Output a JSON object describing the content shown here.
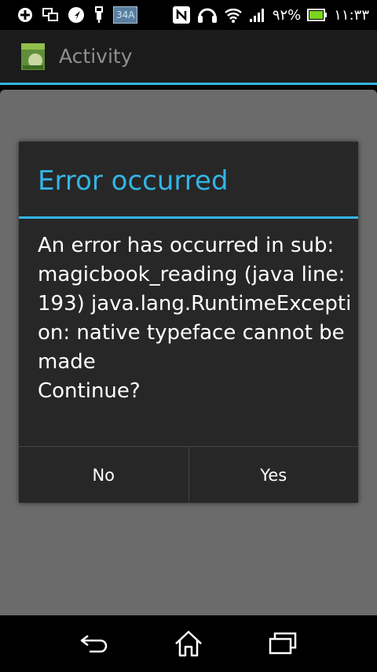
{
  "status_bar": {
    "badge_text": "34A",
    "battery_percent": "٩٢%",
    "time": "١١:٣٣",
    "icons": [
      "plus-icon",
      "screens-icon",
      "navigation-icon",
      "usb-icon",
      "image-notification-icon",
      "nfc-icon",
      "headset-icon",
      "wifi-icon",
      "signal-icon",
      "battery-icon"
    ]
  },
  "action_bar": {
    "title": "Activity"
  },
  "dialog": {
    "title": "Error occurred",
    "message": "An error has occurred in sub:magicbook_reading (java line: 193) java.lang.RuntimeException: native typeface cannot be made\nContinue?",
    "negative_label": "No",
    "positive_label": "Yes"
  },
  "nav_bar": {
    "icons": [
      "back-icon",
      "home-icon",
      "recents-icon"
    ]
  },
  "colors": {
    "accent": "#33b5e5",
    "dialog_bg": "#272727",
    "dim_bg": "#6b6b6b"
  }
}
